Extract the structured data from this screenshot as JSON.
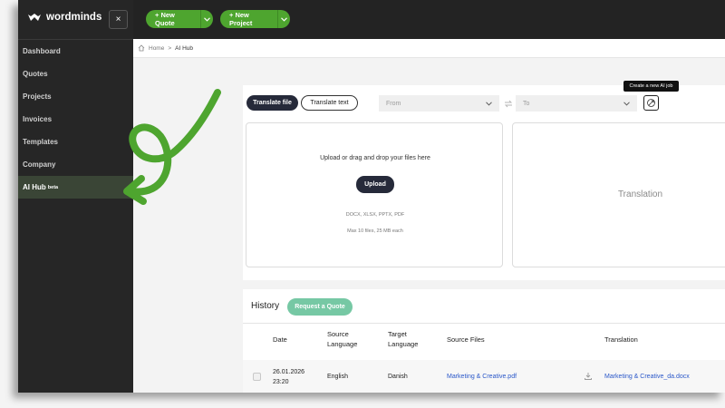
{
  "brand": {
    "name": "wordminds"
  },
  "sidebar": {
    "close_label": "×",
    "items": [
      {
        "label": "Dashboard"
      },
      {
        "label": "Quotes"
      },
      {
        "label": "Projects"
      },
      {
        "label": "Invoices"
      },
      {
        "label": "Templates"
      },
      {
        "label": "Company"
      },
      {
        "label": "AI Hub",
        "badge": "beta",
        "active": true
      }
    ]
  },
  "topbar": {
    "new_quote": "+ New Quote",
    "new_project": "+ New Project"
  },
  "breadcrumb": {
    "home": "Home",
    "separator": ">",
    "current": "AI Hub"
  },
  "translator": {
    "tab_file": "Translate file",
    "tab_text": "Translate text",
    "from_placeholder": "From",
    "to_placeholder": "To",
    "tooltip": "Create a new AI job",
    "upload_prompt": "Upload or drag and drop your files here",
    "upload_button": "Upload",
    "formats": "DOCX, XLSX, PPTX, PDF",
    "limits": "Max 10 files, 25 MB each",
    "translation_placeholder": "Translation"
  },
  "history": {
    "title": "History",
    "request_quote": "Request a Quote",
    "columns": {
      "date": "Date",
      "source_language": "Source Language",
      "target_language": "Target Language",
      "source_files": "Source Files",
      "translation": "Translation"
    },
    "rows": [
      {
        "date": "26.01.2026",
        "time": "23:20",
        "source_language": "English",
        "target_language": "Danish",
        "source_file": "Marketing & Creative.pdf",
        "translation_file": "Marketing & Creative_da.docx"
      }
    ]
  },
  "colors": {
    "accent_green": "#4ea52f",
    "sidebar_bg": "#262626",
    "active_nav_bg": "#3a4536",
    "link_blue": "#2b58c9",
    "annotation_arrow": "#4ea52f"
  }
}
